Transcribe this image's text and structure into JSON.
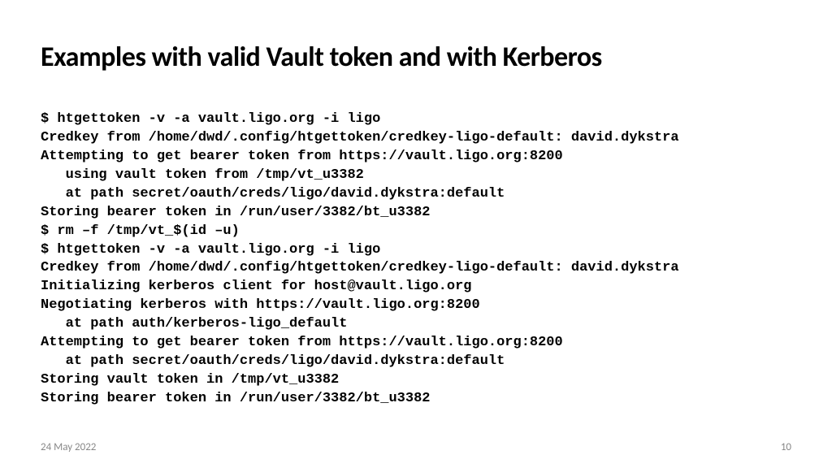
{
  "title": "Examples with valid Vault token and with Kerberos",
  "terminal": {
    "l1": "$ htgettoken -v -a vault.ligo.org -i ligo",
    "l2": "Credkey from /home/dwd/.config/htgettoken/credkey-ligo-default: david.dykstra",
    "l3": "Attempting to get bearer token from https://vault.ligo.org:8200",
    "l4": "   using vault token from /tmp/vt_u3382",
    "l5": "   at path secret/oauth/creds/ligo/david.dykstra:default",
    "l6": "Storing bearer token in /run/user/3382/bt_u3382",
    "l7": "$ rm –f /tmp/vt_$(id –u)",
    "l8": "$ htgettoken -v -a vault.ligo.org -i ligo",
    "l9": "Credkey from /home/dwd/.config/htgettoken/credkey-ligo-default: david.dykstra",
    "l10": "Initializing kerberos client for host@vault.ligo.org",
    "l11": "Negotiating kerberos with https://vault.ligo.org:8200",
    "l12": "   at path auth/kerberos-ligo_default",
    "l13": "Attempting to get bearer token from https://vault.ligo.org:8200",
    "l14": "   at path secret/oauth/creds/ligo/david.dykstra:default",
    "l15": "Storing vault token in /tmp/vt_u3382",
    "l16": "Storing bearer token in /run/user/3382/bt_u3382"
  },
  "footer": {
    "date": "24 May 2022",
    "page": "10"
  }
}
